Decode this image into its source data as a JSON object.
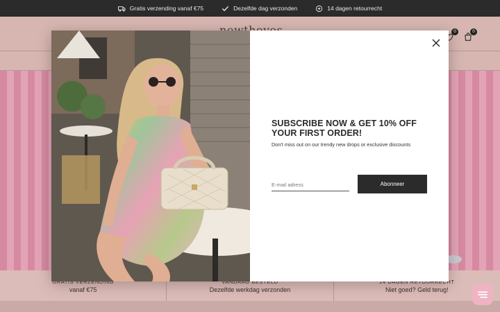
{
  "topbar": {
    "usps": [
      {
        "icon": "truck-icon",
        "label": "Gratis verzending vanaf €75"
      },
      {
        "icon": "check-icon",
        "label": "Dezelfde dag verzonden"
      },
      {
        "icon": "return-icon",
        "label": "14 dagen retourrecht"
      }
    ]
  },
  "header": {
    "logo": "nowthoves",
    "wishlist_count": "0",
    "cart_count": "0"
  },
  "bottom_usps": [
    {
      "title": "Gratis verzending",
      "subtitle": "vanaf €75"
    },
    {
      "title": "Vandaag besteld",
      "subtitle": "Dezelfde werkdag verzonden"
    },
    {
      "title": "14 dagen retourrecht",
      "subtitle": "Niet goed? Geld terug!"
    }
  ],
  "modal": {
    "headline": "SUBSCRIBE NOW & GET 10% OFF YOUR FIRST ORDER!",
    "subtext": "Don't miss out on our trendy new drops or exclusive discounts",
    "email_placeholder": "E-mail adress",
    "button_label": "Abonneer"
  },
  "colors": {
    "dark": "#2b2b2b",
    "overlay_pink": "#d7b6b1",
    "stripe_pink": "#d68aa2",
    "chat_pink": "#efb3c3"
  }
}
